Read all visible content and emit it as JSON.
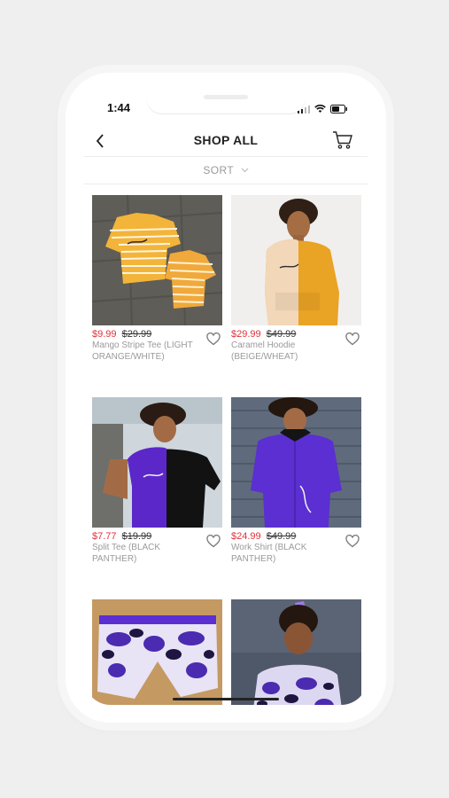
{
  "status": {
    "time": "1:44"
  },
  "header": {
    "title": "SHOP ALL"
  },
  "sort": {
    "label": "SORT"
  },
  "products": [
    {
      "sale_price": "$9.99",
      "orig_price": "$29.99",
      "name": "Mango Stripe Tee (LIGHT ORANGE/WHITE)"
    },
    {
      "sale_price": "$29.99",
      "orig_price": "$49.99",
      "name": "Caramel Hoodie (BEIGE/WHEAT)"
    },
    {
      "sale_price": "$7.77",
      "orig_price": "$19.99",
      "name": "Split Tee (BLACK PANTHER)"
    },
    {
      "sale_price": "$24.99",
      "orig_price": "$49.99",
      "name": "Work Shirt (BLACK PANTHER)"
    },
    {
      "sale_price": "",
      "orig_price": "",
      "name": ""
    },
    {
      "sale_price": "",
      "orig_price": "",
      "name": ""
    }
  ],
  "colors": {
    "sale": "#e0313b",
    "muted": "#9a9a9a",
    "brand_purple": "#5b2fd1"
  }
}
